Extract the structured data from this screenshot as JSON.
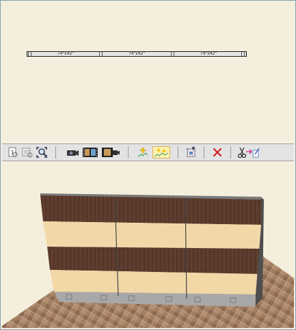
{
  "plan_view": {
    "wall_segments": [
      {
        "label": "74\"x42\""
      },
      {
        "label": "74\"x42\""
      },
      {
        "label": "74\"x42\""
      }
    ]
  },
  "toolbar": {
    "buttons": [
      {
        "icon": "zoom-page-icon"
      },
      {
        "icon": "zoom-window-icon"
      },
      {
        "icon": "zoom-extents-icon"
      },
      {
        "icon": "camera-icon"
      },
      {
        "icon": "film-strip-icon"
      },
      {
        "icon": "film-camera-icon"
      },
      {
        "icon": "sparkle-render-icon"
      },
      {
        "icon": "sparkle-render-all-icon",
        "active": true
      },
      {
        "icon": "select-area-icon"
      },
      {
        "icon": "delete-icon"
      },
      {
        "icon": "cut-paste-icon"
      }
    ]
  },
  "colors": {
    "background": "#f4efdc",
    "dark_wood": "#5a3a2c",
    "light_wood": "#f0d6a6",
    "floor": "#a07a5d",
    "base": "#a6a6a6",
    "delete_red": "#cc2020"
  }
}
